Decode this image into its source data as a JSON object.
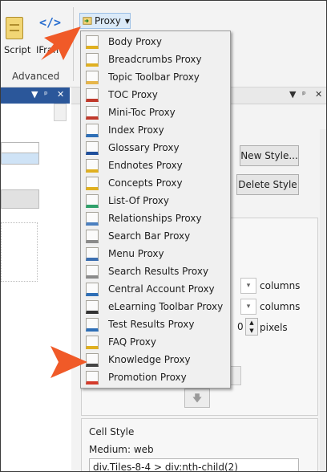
{
  "ribbon": {
    "script_label": "Script",
    "iframe_label": "IFrame",
    "group_label": "Advanced",
    "proxy_label": "Proxy",
    "iframe_glyph": "</>"
  },
  "left_panel": {
    "controls": [
      "▼",
      "ᵖ",
      "✕"
    ]
  },
  "right_panel": {
    "controls": [
      "▼",
      "ᵖ",
      "✕"
    ],
    "new_style_label": "New Style...",
    "delete_style_label": "Delete Style",
    "columns_label_1": "columns",
    "columns_label_2": "columns",
    "pixels_label": "pixels",
    "spin_value": "0",
    "cell_style_label": "Cell Style",
    "medium_label": "Medium: web",
    "selector_value": "div.Tiles-8-4 > div:nth-child(2)"
  },
  "proxy_menu": {
    "items": [
      {
        "label": "Body Proxy",
        "icon": "body-proxy-icon",
        "accent": "#e0b020"
      },
      {
        "label": "Breadcrumbs Proxy",
        "icon": "breadcrumbs-proxy-icon",
        "accent": "#e0b020"
      },
      {
        "label": "Topic Toolbar Proxy",
        "icon": "topic-toolbar-proxy-icon",
        "accent": "#e7b64a"
      },
      {
        "label": "TOC Proxy",
        "icon": "toc-proxy-icon",
        "accent": "#c0392b"
      },
      {
        "label": "Mini-Toc Proxy",
        "icon": "mini-toc-proxy-icon",
        "accent": "#c0392b"
      },
      {
        "label": "Index Proxy",
        "icon": "index-proxy-icon",
        "accent": "#2e6fb7"
      },
      {
        "label": "Glossary Proxy",
        "icon": "glossary-proxy-icon",
        "accent": "#1f4f9c"
      },
      {
        "label": "Endnotes Proxy",
        "icon": "endnotes-proxy-icon",
        "accent": "#e0b020"
      },
      {
        "label": "Concepts Proxy",
        "icon": "concepts-proxy-icon",
        "accent": "#e0b020"
      },
      {
        "label": "List-Of Proxy",
        "icon": "list-of-proxy-icon",
        "accent": "#2ea06a"
      },
      {
        "label": "Relationships Proxy",
        "icon": "relationships-proxy-icon",
        "accent": "#4a7fc0"
      },
      {
        "label": "Search Bar Proxy",
        "icon": "search-bar-proxy-icon",
        "accent": "#8a8a8a"
      },
      {
        "label": "Menu Proxy",
        "icon": "menu-proxy-icon",
        "accent": "#3c6fb0"
      },
      {
        "label": "Search Results Proxy",
        "icon": "search-results-proxy-icon",
        "accent": "#8a8a8a"
      },
      {
        "label": "Central Account Proxy",
        "icon": "central-account-proxy-icon",
        "accent": "#2e6fb7"
      },
      {
        "label": "eLearning Toolbar Proxy",
        "icon": "elearning-toolbar-proxy-icon",
        "accent": "#333333"
      },
      {
        "label": "Test Results Proxy",
        "icon": "test-results-proxy-icon",
        "accent": "#2e6fb7"
      },
      {
        "label": "FAQ Proxy",
        "icon": "faq-proxy-icon",
        "accent": "#e0b020"
      },
      {
        "label": "Knowledge Proxy",
        "icon": "knowledge-proxy-icon",
        "accent": "#444444"
      },
      {
        "label": "Promotion Proxy",
        "icon": "promotion-proxy-icon",
        "accent": "#d43a2a"
      }
    ]
  },
  "colors": {
    "callout_arrow": "#f05a28",
    "panel_title": "#2b579a",
    "proxy_highlight": "#dbeaf8"
  }
}
